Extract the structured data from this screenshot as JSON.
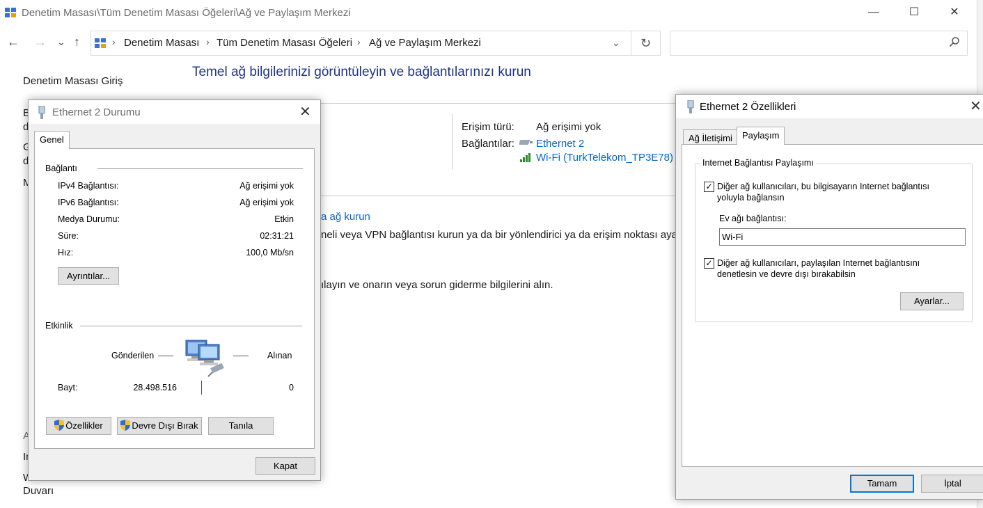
{
  "window": {
    "title": "Denetim Masası\\Tüm Denetim Masası Öğeleri\\Ağ ve Paylaşım Merkezi",
    "minimize": "—",
    "maximize": "☐",
    "close": "✕"
  },
  "nav": {
    "back": "←",
    "forward": "→",
    "recent": "⌄",
    "up": "↑",
    "breadcrumbs": [
      "Denetim Masası",
      "Tüm Denetim Masası Öğeleri",
      "Ağ ve Paylaşım Merkezi"
    ],
    "refresh": "↻",
    "search_placeholder": "",
    "search_icon": "⚲"
  },
  "sidebar": {
    "home": "Denetim Masası Giriş",
    "partial_b": "B",
    "partial_d1": "d",
    "partial_g": "G",
    "partial_d2": "d",
    "partial_m": "M",
    "partial_a": "A",
    "partial_in": "In",
    "partial_w": "W",
    "duvari": "Duvarı"
  },
  "main": {
    "heading": "Temel ağ bilgilerinizi görüntüleyin ve bağlantılarınızı kurun",
    "access_type_label": "Erişim türü:",
    "access_type_value": "Ağ erişimi yok",
    "connections_label": "Bağlantılar:",
    "connection_1": "Ethernet 2",
    "connection_2": "Wi-Fi (TurkTelekom_TP3E78)",
    "setup_link_partial": "a ağ kurun",
    "setup_desc_partial": "neli veya VPN bağlantısı kurun ya da bir yönlendirici ya da erişim noktası ayarla",
    "troubleshoot_partial": "ılayın ve onarın veya sorun giderme bilgilerini alın."
  },
  "status_dialog": {
    "title": "Ethernet 2 Durumu",
    "tab": "Genel",
    "connection_group": "Bağlantı",
    "rows": [
      {
        "label": "IPv4 Bağlantısı:",
        "value": "Ağ erişimi yok"
      },
      {
        "label": "IPv6 Bağlantısı:",
        "value": "Ağ erişimi yok"
      },
      {
        "label": "Medya Durumu:",
        "value": "Etkin"
      },
      {
        "label": "Süre:",
        "value": "02:31:21"
      },
      {
        "label": "Hız:",
        "value": "100,0 Mb/sn"
      }
    ],
    "details_button": "Ayrıntılar...",
    "activity_group": "Etkinlik",
    "sent_label": "Gönderilen",
    "received_label": "Alınan",
    "bytes_label": "Bayt:",
    "bytes_sent": "28.498.516",
    "bytes_received": "0",
    "properties_button": "Özellikler",
    "disable_button": "Devre Dışı Bırak",
    "diagnose_button": "Tanıla",
    "close_button": "Kapat"
  },
  "props_dialog": {
    "title": "Ethernet 2 Özellikleri",
    "tab_network": "Ağ İletişimi",
    "tab_sharing": "Paylaşım",
    "group_title": "Internet Bağlantısı Paylaşımı",
    "check1_line1": "Diğer ağ kullanıcıları, bu bilgisayarın Internet bağlantısı",
    "check1_line2": "yoluyla bağlansın",
    "home_conn_label": "Ev ağı bağlantısı:",
    "home_conn_value": "Wi-Fi",
    "check2_line1": "Diğer ağ kullanıcıları, paylaşılan Internet bağlantısını",
    "check2_line2": "denetlesin ve devre dışı bırakabilsin",
    "settings_button": "Ayarlar...",
    "ok_button": "Tamam",
    "cancel_button": "İptal",
    "check_mark": "✓"
  },
  "colors": {
    "heading": "#1e3287",
    "link": "#0066cc",
    "accent": "#0078d7"
  }
}
